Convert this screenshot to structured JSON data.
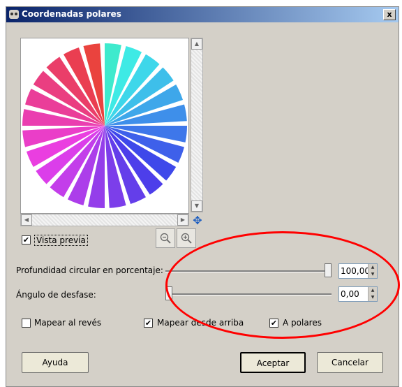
{
  "window": {
    "title": "Coordenadas polares",
    "close_label": "x"
  },
  "preview": {
    "checkbox_label": "Vista previa",
    "checked": true,
    "mark": "✔"
  },
  "zoom": {
    "zoom_out_icon": "zoom-out-icon",
    "zoom_in_icon": "zoom-in-icon"
  },
  "sliders": [
    {
      "label": "Profundidad circular en porcentaje:",
      "value": "100,00",
      "fraction": 1.0
    },
    {
      "label": "Ángulo de desfase:",
      "value": "0,00",
      "fraction": 0.0
    }
  ],
  "options": [
    {
      "label": "Mapear al revés",
      "checked": false
    },
    {
      "label": "Mapear desde arriba",
      "checked": true
    },
    {
      "label": "A polares",
      "checked": true
    }
  ],
  "buttons": {
    "help": "Ayuda",
    "accept": "Aceptar",
    "cancel": "Cancelar"
  },
  "colors": {
    "titlebar_start": "#0a246a",
    "titlebar_end": "#a6caf0",
    "annotation": "#ff0000",
    "dialog_bg": "#d4d0c8"
  }
}
